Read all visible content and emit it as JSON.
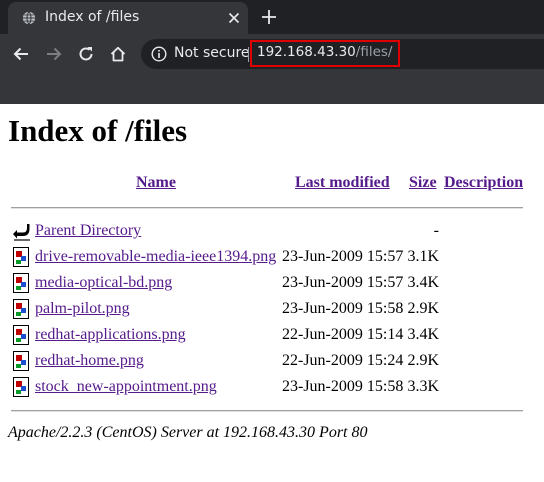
{
  "browser": {
    "tab": {
      "title": "Index of /files",
      "favicon": "globe-icon",
      "close_icon": "close-icon"
    },
    "new_tab_icon": "plus-icon",
    "nav": {
      "back_icon": "back-arrow-icon",
      "forward_icon": "forward-arrow-icon",
      "reload_icon": "reload-icon",
      "home_icon": "home-icon"
    },
    "omnibox": {
      "security_icon": "info-icon",
      "security_label": "Not secure",
      "url_host": "192.168.43.30",
      "url_path": "/files/"
    },
    "colors": {
      "tab_bar": "#202124",
      "toolbar": "#35363a",
      "highlight_box": "#e00000"
    }
  },
  "page": {
    "title": "Index of /files",
    "columns": {
      "name": "Name",
      "last_modified": "Last modified",
      "size": "Size",
      "description": "Description"
    },
    "parent": {
      "name": "Parent Directory",
      "size": "-",
      "icon": "back-folder-icon"
    },
    "files": [
      {
        "name": "drive-removable-media-ieee1394.png",
        "modified": "23-Jun-2009 15:57",
        "size": "3.1K",
        "icon": "image-file-icon"
      },
      {
        "name": "media-optical-bd.png",
        "modified": "23-Jun-2009 15:57",
        "size": "3.4K",
        "icon": "image-file-icon"
      },
      {
        "name": "palm-pilot.png",
        "modified": "23-Jun-2009 15:58",
        "size": "2.9K",
        "icon": "image-file-icon"
      },
      {
        "name": "redhat-applications.png",
        "modified": "22-Jun-2009 15:14",
        "size": "3.4K",
        "icon": "image-file-icon"
      },
      {
        "name": "redhat-home.png",
        "modified": "22-Jun-2009 15:24",
        "size": "2.9K",
        "icon": "image-file-icon"
      },
      {
        "name": "stock_new-appointment.png",
        "modified": "23-Jun-2009 15:58",
        "size": "3.3K",
        "icon": "image-file-icon"
      }
    ],
    "footer": "Apache/2.2.3 (CentOS) Server at 192.168.43.30 Port 80",
    "colors": {
      "link": "#551a8b"
    }
  }
}
